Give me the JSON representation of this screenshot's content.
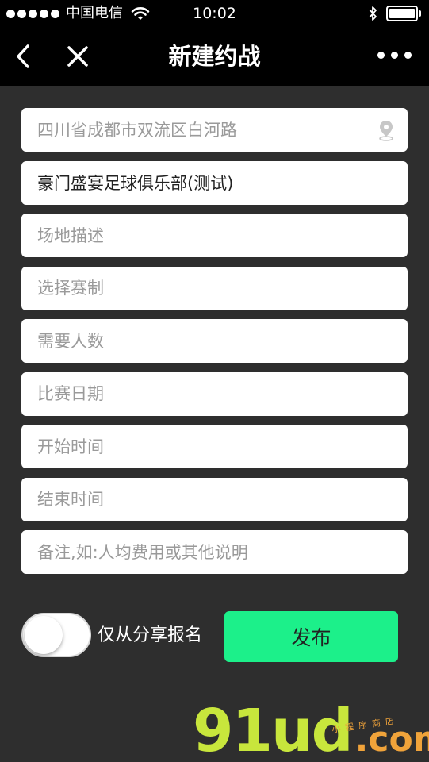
{
  "status_bar": {
    "carrier": "中国电信",
    "time": "10:02"
  },
  "nav": {
    "title": "新建约战",
    "back_icon": "chevron-left-icon",
    "close_icon": "close-icon",
    "more_icon": "more-dots-icon"
  },
  "form": {
    "address": {
      "value": "",
      "placeholder": "四川省成都市双流区白河路"
    },
    "club": {
      "value": "豪门盛宴足球俱乐部(测试)",
      "placeholder": ""
    },
    "venue_desc": {
      "value": "",
      "placeholder": "场地描述"
    },
    "format": {
      "value": "",
      "placeholder": "选择赛制"
    },
    "players_needed": {
      "value": "",
      "placeholder": "需要人数"
    },
    "match_date": {
      "value": "",
      "placeholder": "比赛日期"
    },
    "start_time": {
      "value": "",
      "placeholder": "开始时间"
    },
    "end_time": {
      "value": "",
      "placeholder": "结束时间"
    },
    "notes": {
      "value": "",
      "placeholder": "备注,如:人均费用或其他说明"
    }
  },
  "share_toggle": {
    "label": "仅从分享报名",
    "on": false
  },
  "publish_button": {
    "label": "发布",
    "color": "#1cf08a"
  },
  "watermark": {
    "logo": "91ud",
    "tld": ".com",
    "sub": "小程序商店"
  },
  "colors": {
    "background": "#2e2e2e",
    "bar": "#000000",
    "accent": "#1cf08a"
  }
}
